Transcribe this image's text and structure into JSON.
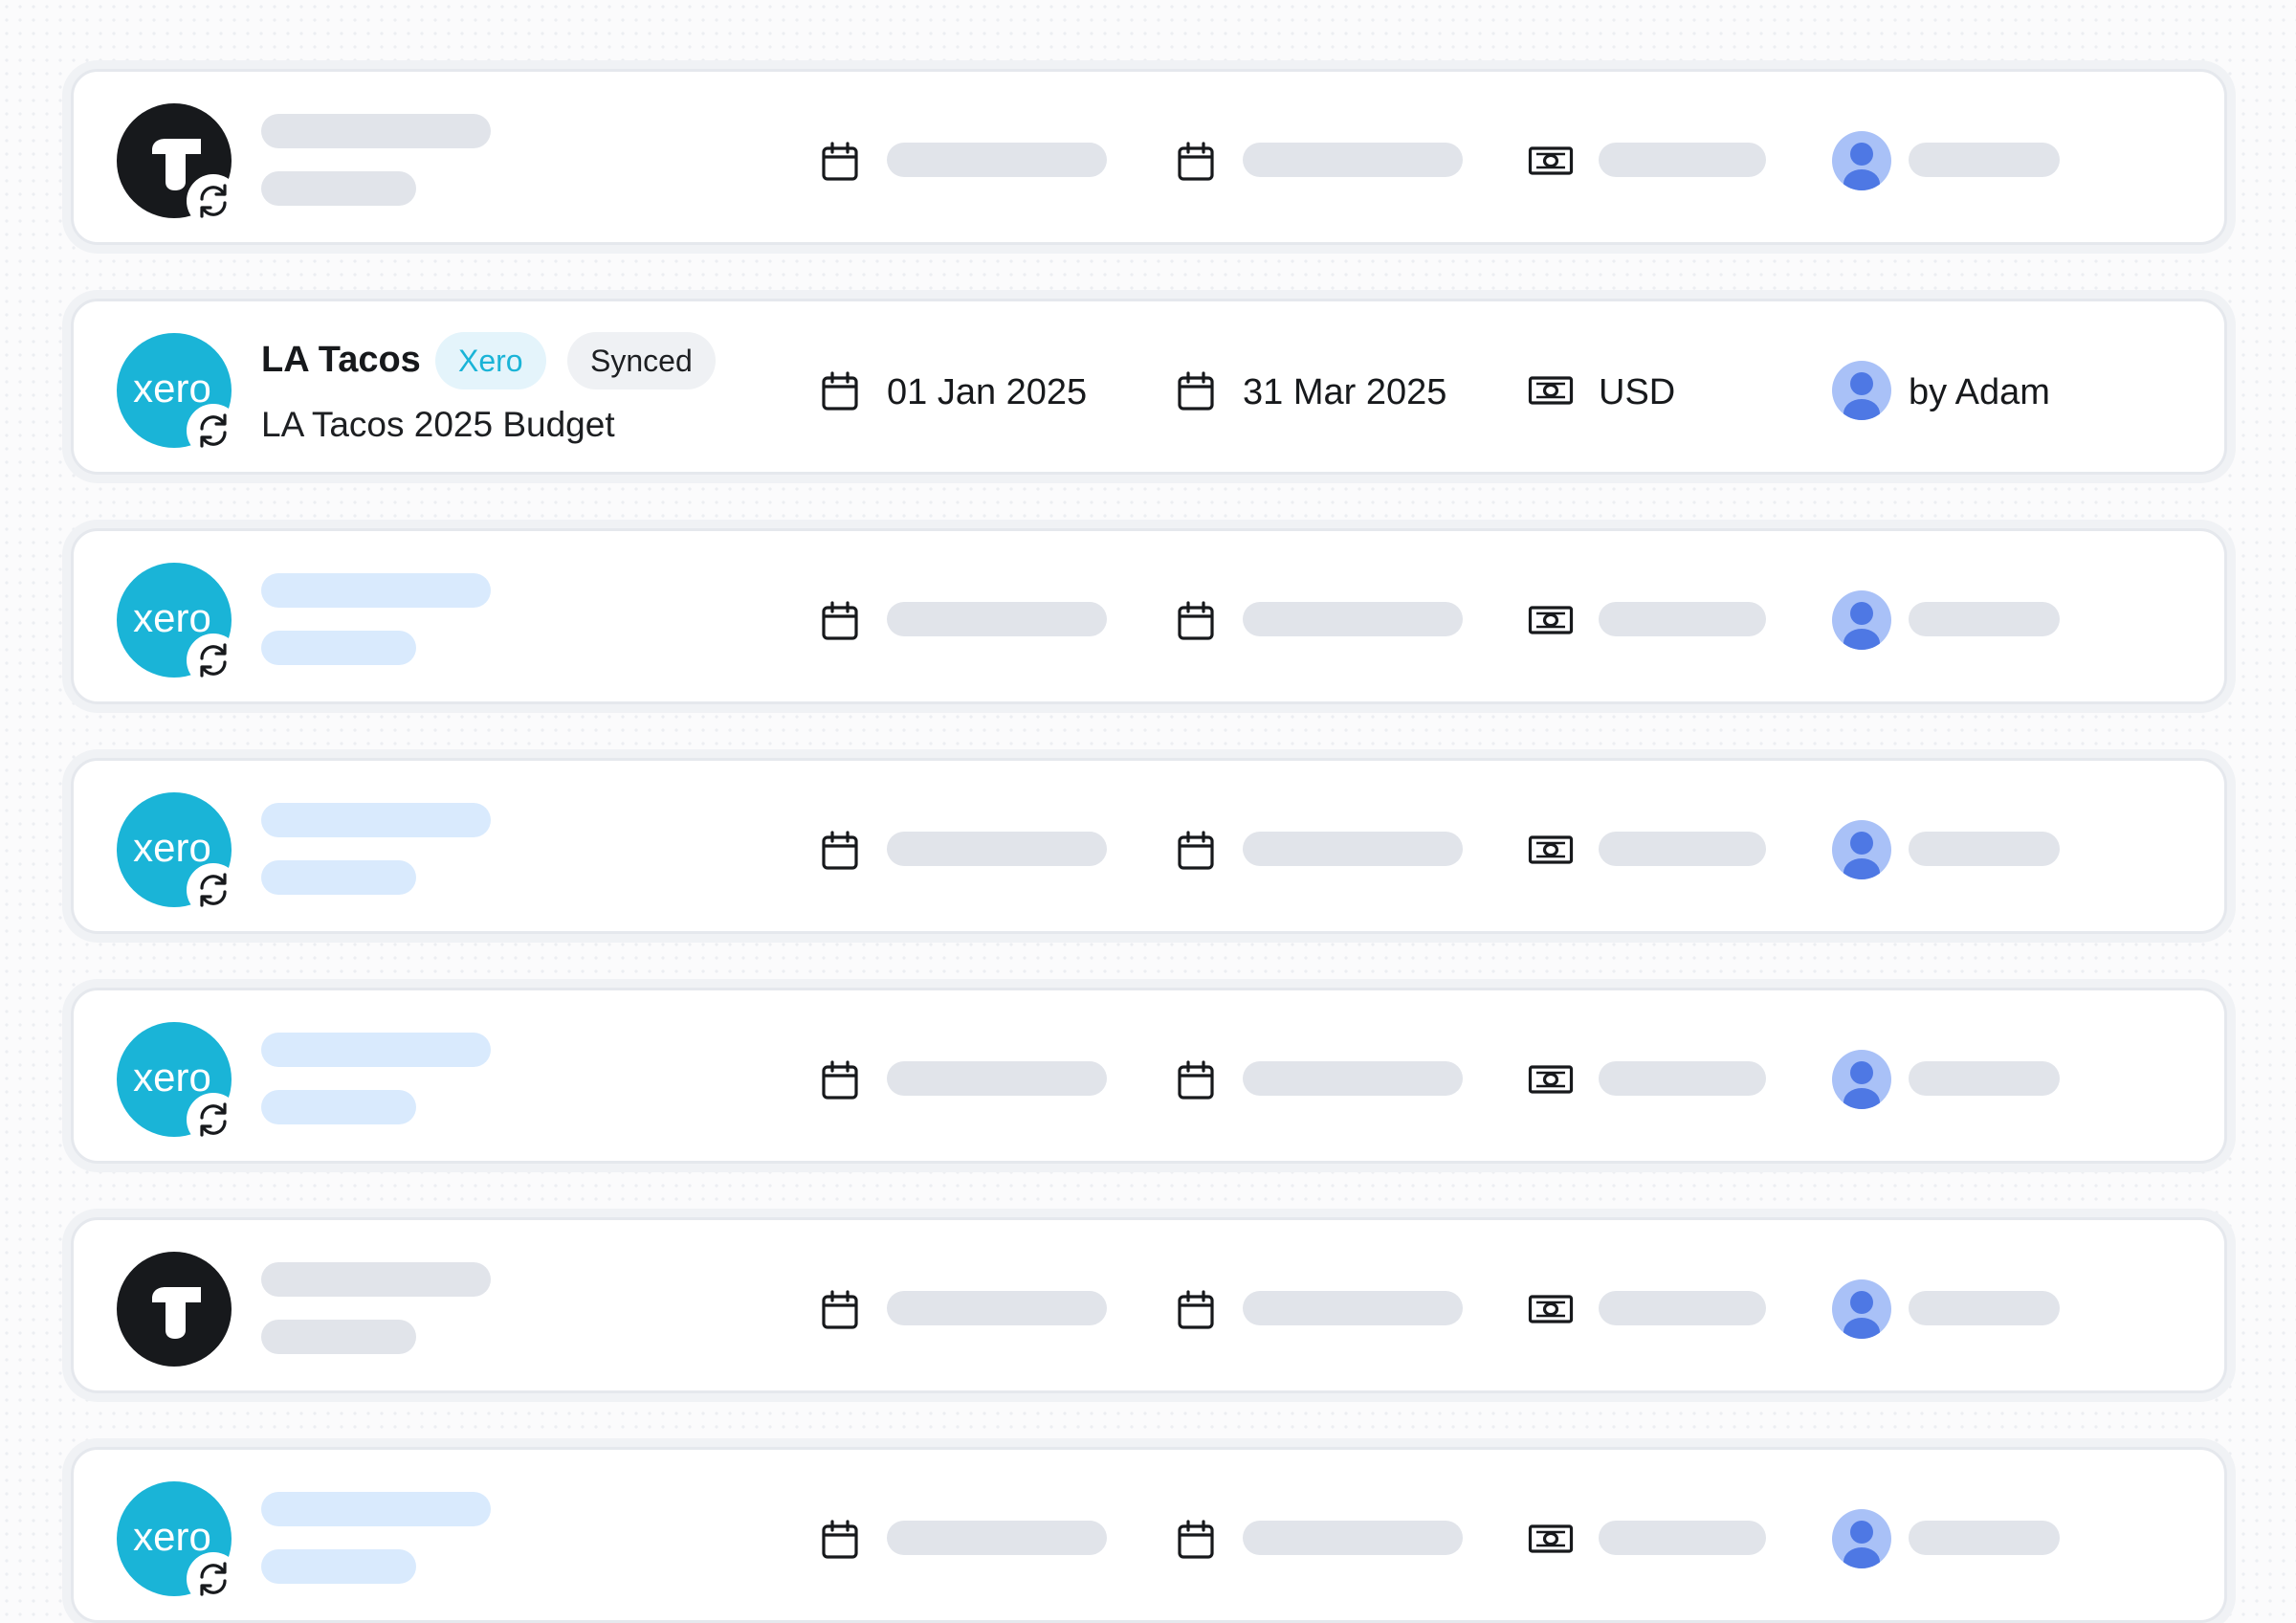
{
  "colors": {
    "xero_brand": "#1ab4d7",
    "tactic_brand": "#17191c",
    "skeleton_gray": "#e1e4ea",
    "skeleton_blue": "#d9eafd",
    "avatar_bg": "#a9c1f7",
    "avatar_fg": "#4e78e4",
    "pill_source_bg": "#e4f4fb",
    "pill_status_bg": "#eff1f4"
  },
  "rows": [
    {
      "logo": "tactic-logo-icon",
      "loading": true,
      "sync_icon": true
    },
    {
      "logo": "xero-logo-icon",
      "loading": false,
      "sync_icon": true,
      "logo_text": "xero",
      "name": "LA Tacos",
      "source_badge": "Xero",
      "status_badge": "Synced",
      "subtitle": "LA Tacos 2025 Budget",
      "start_date": "01 Jan 2025",
      "end_date": "31 Mar 2025",
      "currency": "USD",
      "owner": "by Adam"
    },
    {
      "logo": "xero-logo-icon",
      "loading": true,
      "sync_icon": true,
      "logo_text": "xero"
    },
    {
      "logo": "xero-logo-icon",
      "loading": true,
      "sync_icon": true,
      "logo_text": "xero"
    },
    {
      "logo": "xero-logo-icon",
      "loading": true,
      "sync_icon": true,
      "logo_text": "xero"
    },
    {
      "logo": "tactic-logo-icon",
      "loading": true,
      "sync_icon": false
    },
    {
      "logo": "xero-logo-icon",
      "loading": true,
      "sync_icon": true,
      "logo_text": "xero"
    }
  ],
  "icons": {
    "start_date": "calendar-icon",
    "end_date": "calendar-icon",
    "currency": "cash-icon",
    "owner": "user-avatar-icon",
    "sync": "sync-icon"
  }
}
